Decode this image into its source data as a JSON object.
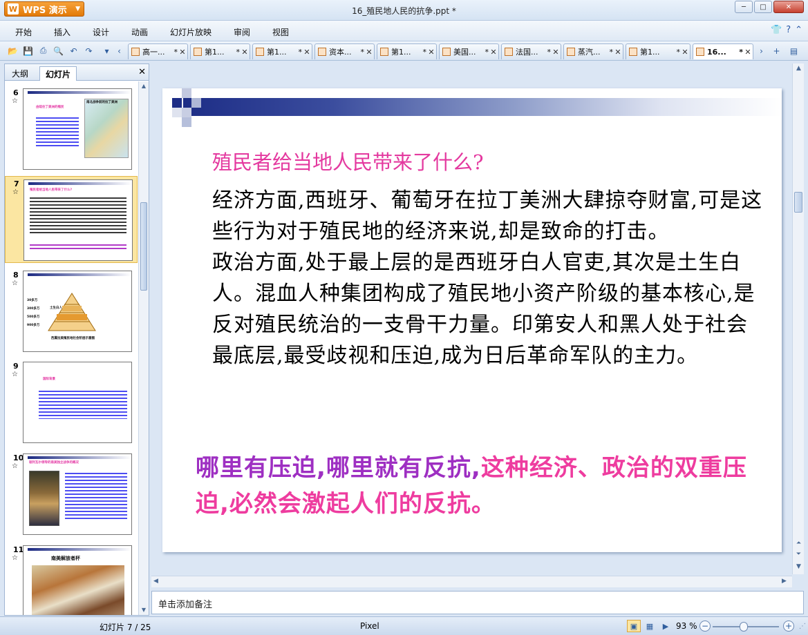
{
  "app": {
    "name": "WPS 演示",
    "document_title": "16_殖民地人民的抗争.ppt *"
  },
  "window_controls": {
    "minimize": "─",
    "maximize": "□",
    "close": "✕"
  },
  "menu": [
    "开始",
    "插入",
    "设计",
    "动画",
    "幻灯片放映",
    "审阅",
    "视图"
  ],
  "doc_tabs": [
    {
      "label": "高一...",
      "modified": "*"
    },
    {
      "label": "第1...",
      "modified": "*"
    },
    {
      "label": "第1...",
      "modified": "*"
    },
    {
      "label": "资本...",
      "modified": "*"
    },
    {
      "label": "第1...",
      "modified": "*"
    },
    {
      "label": "美国...",
      "modified": "*"
    },
    {
      "label": "法国...",
      "modified": "*"
    },
    {
      "label": "蒸汽...",
      "modified": "*"
    },
    {
      "label": "第1...",
      "modified": "*"
    },
    {
      "label": "16...",
      "modified": "*"
    }
  ],
  "panel": {
    "tab_outline": "大纲",
    "tab_slides": "幻灯片",
    "close": "✕"
  },
  "thumbnails": [
    {
      "num": "6",
      "title": "由硅往丁美洲的殖民",
      "map_caption": "南北战争前的拉丁美洲"
    },
    {
      "num": "7",
      "title": "殖民者给当地人民带来了什么?"
    },
    {
      "num": "8",
      "caption": "西属拉美殖民地社会阶层示意图",
      "levels": [
        "半岛人",
        "土生白人",
        "混血人种",
        "印第安人和黑人"
      ],
      "left_labels": [
        "30多万",
        "300多万",
        "500多万",
        "900多万"
      ]
    },
    {
      "num": "9",
      "title": "国际背景"
    },
    {
      "num": "10",
      "title": "玻利瓦尔领导的南美独立战争的概况"
    },
    {
      "num": "11",
      "title": "南美解放者杯"
    }
  ],
  "slide": {
    "heading": "殖民者给当地人民带来了什么?",
    "paragraphs": [
      "经济方面,西班牙、葡萄牙在拉丁美洲大肆掠夺财富,可是这些行为对于殖民地的经济来说,却是致命的打击。",
      "政治方面,处于最上层的是西班牙白人官吏,其次是土生白人。混血人种集团构成了殖民地小资产阶级的基本核心,是反对殖民统治的一支骨干力量。印第安人和黑人处于社会最底层,最受歧视和压迫,成为日后革命军队的主力。"
    ],
    "conclusion_part1": "哪里有压迫,哪里就有反抗,",
    "conclusion_part2": "这种经济、政治的双重压迫,必然会激起人们的反抗。"
  },
  "notes_placeholder": "单击添加备注",
  "status": {
    "slide_info": "幻灯片 7 / 25",
    "theme": "Pixel",
    "zoom": "93 %"
  },
  "zoom_level_percent": 93,
  "colors": {
    "heading_pink": "#e4399f",
    "conclusion_purple": "#9e2fc2",
    "conclusion_pink": "#ee3c9f",
    "accent_orange": "#e27a08"
  }
}
